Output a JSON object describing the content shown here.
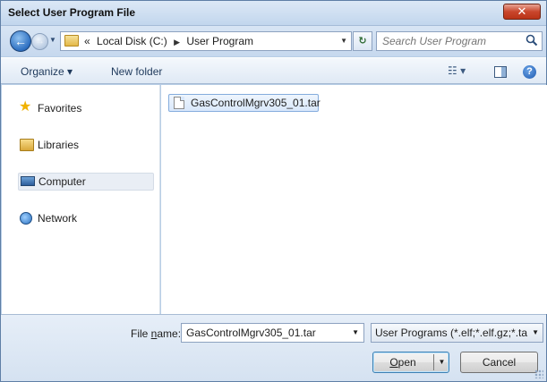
{
  "window": {
    "title": "Select User Program File",
    "close_label": "✕"
  },
  "nav": {
    "back_icon": "back-arrow-icon",
    "forward_icon": "forward-arrow-icon",
    "breadcrumb_prefix": "«",
    "breadcrumbs": [
      "Local Disk (C:)",
      "User Program"
    ],
    "search_placeholder": "Search User Program"
  },
  "toolbar": {
    "organize_label": "Organize ▾",
    "new_folder_label": "New folder"
  },
  "sidebar": {
    "items": [
      {
        "label": "Favorites",
        "icon": "star-icon"
      },
      {
        "label": "Libraries",
        "icon": "library-icon"
      },
      {
        "label": "Computer",
        "icon": "computer-icon",
        "selected": true
      },
      {
        "label": "Network",
        "icon": "network-icon"
      }
    ]
  },
  "files": [
    {
      "name": "GasControlMgrv305_01.tar",
      "selected": true
    }
  ],
  "footer": {
    "file_name_label_pre": "File ",
    "file_name_label_ul": "n",
    "file_name_label_post": "ame:",
    "file_name_value": "GasControlMgrv305_01.tar",
    "filter_value": "User Programs (*.elf;*.elf.gz;*.ta",
    "open_label_ul": "O",
    "open_label_rest": "pen",
    "cancel_label": "Cancel"
  },
  "colors": {
    "chrome": "#c9dbee",
    "selection": "#d9e8fb",
    "close": "#c9462c"
  }
}
